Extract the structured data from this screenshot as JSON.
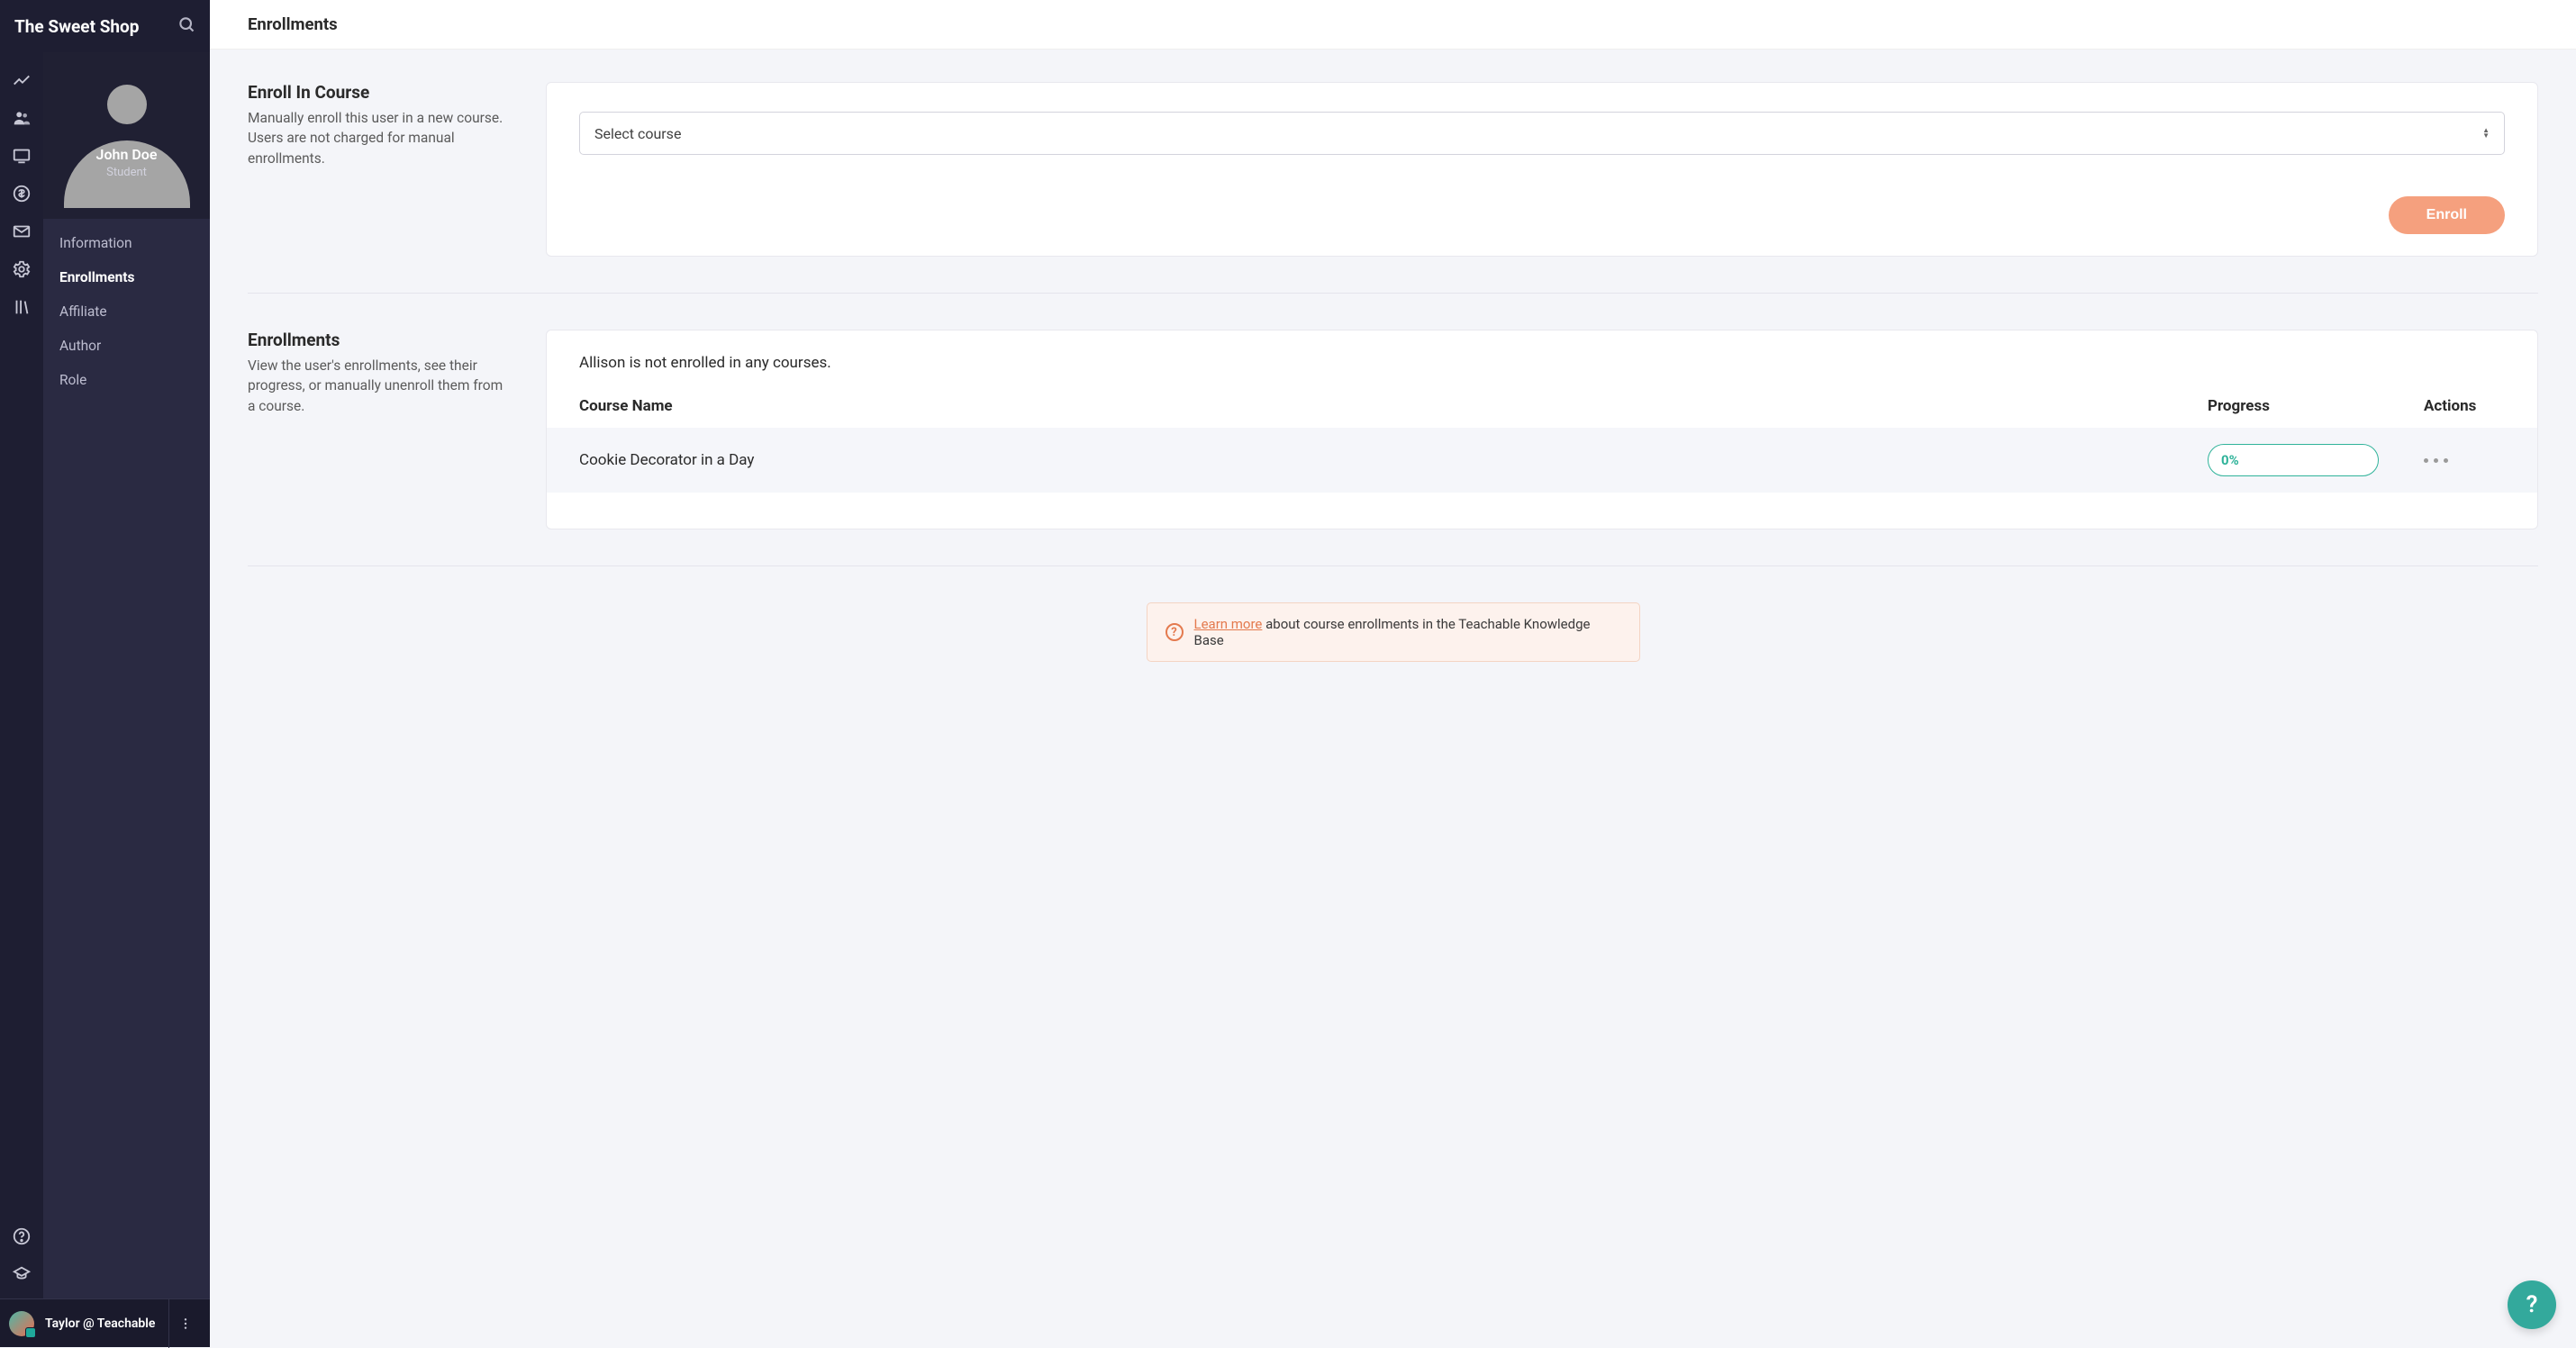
{
  "app": {
    "title": "The Sweet Shop"
  },
  "user_card": {
    "name": "John Doe",
    "role": "Student"
  },
  "sidebar": {
    "items": [
      {
        "label": "Information"
      },
      {
        "label": "Enrollments"
      },
      {
        "label": "Affiliate"
      },
      {
        "label": "Author"
      },
      {
        "label": "Role"
      }
    ],
    "active_index": 1
  },
  "footer": {
    "user": "Taylor @ Teachable"
  },
  "page": {
    "title": "Enrollments"
  },
  "enroll_section": {
    "heading": "Enroll In Course",
    "description": "Manually enroll this user in a new course. Users are not charged for manual enrollments.",
    "select_placeholder": "Select course",
    "button_label": "Enroll"
  },
  "enrollments_section": {
    "heading": "Enrollments",
    "description": "View the user's enrollments, see their progress, or manually unenroll them from a course.",
    "empty_text": "Allison is not enrolled in any courses.",
    "columns": {
      "course": "Course Name",
      "progress": "Progress",
      "actions": "Actions"
    },
    "rows": [
      {
        "course_name": "Cookie Decorator in a Day",
        "progress": "0%"
      }
    ]
  },
  "help_banner": {
    "link_text": "Learn more",
    "rest_text": " about course enrollments in the Teachable Knowledge Base"
  },
  "colors": {
    "accent_teal": "#30b39a",
    "accent_orange": "#f07d52",
    "sidebar_dark": "#2a2a42",
    "rail_dark": "#1e1e32"
  }
}
